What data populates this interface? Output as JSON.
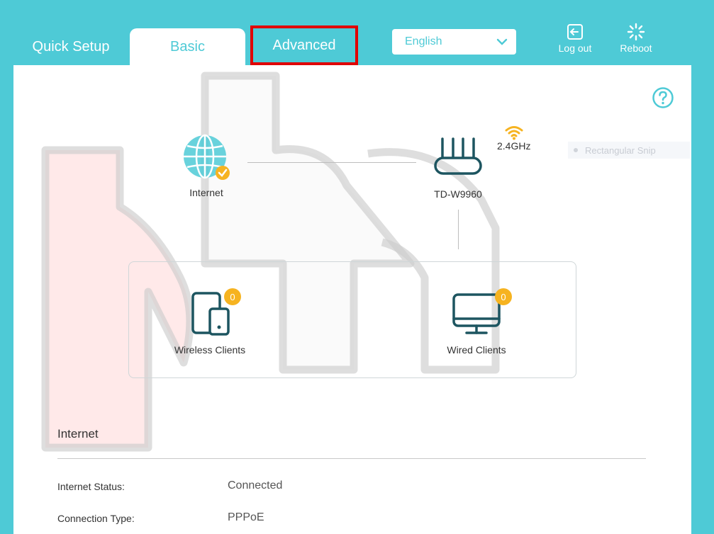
{
  "header": {
    "tabs": [
      "Quick Setup",
      "Basic",
      "Advanced"
    ],
    "language": "English",
    "logout_label": "Log out",
    "reboot_label": "Reboot"
  },
  "topology": {
    "internet_label": "Internet",
    "router_label": "TD-W9960",
    "wifi_band": "2.4GHz",
    "wireless_clients_label": "Wireless Clients",
    "wireless_clients_count": "0",
    "wired_clients_label": "Wired Clients",
    "wired_clients_count": "0"
  },
  "snip_overlay": {
    "label": "Rectangular Snip"
  },
  "internet_section": {
    "title": "Internet",
    "rows": [
      {
        "label": "Internet Status:",
        "value": "Connected"
      },
      {
        "label": "Connection Type:",
        "value": "PPPoE"
      }
    ]
  },
  "colors": {
    "brand": "#4ecad6",
    "icon": "#1d5560",
    "highlight": "#e00000",
    "badge": "#f6b320",
    "wifi": "#f6b320"
  }
}
